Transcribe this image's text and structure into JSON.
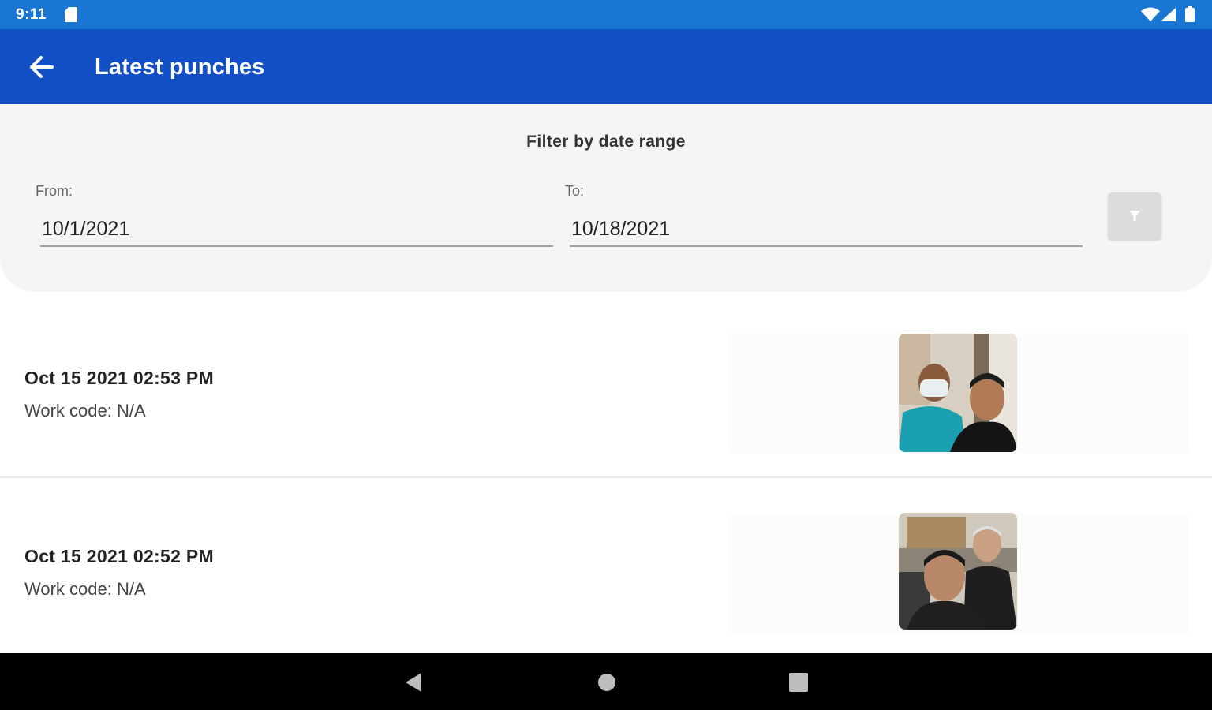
{
  "status_bar": {
    "time": "9:11",
    "icons": [
      "sd-card-icon",
      "wifi-icon",
      "cell-signal-icon",
      "battery-icon"
    ]
  },
  "app_bar": {
    "title": "Latest punches",
    "back_icon": "arrow-back-icon"
  },
  "filter": {
    "heading": "Filter by date range",
    "from_label": "From:",
    "from_value": "10/1/2021",
    "to_label": "To:",
    "to_value": "10/18/2021",
    "apply_icon": "filter-icon"
  },
  "punches": [
    {
      "datetime": "Oct 15 2021 02:53 PM",
      "work_code": "Work code: N/A",
      "photo": "punch-photo"
    },
    {
      "datetime": "Oct 15 2021 02:52 PM",
      "work_code": "Work code: N/A",
      "photo": "punch-photo"
    }
  ],
  "nav_bar": {
    "buttons": [
      "nav-back-icon",
      "nav-home-icon",
      "nav-recents-icon"
    ]
  },
  "colors": {
    "status_bar": "#1976d2",
    "app_bar": "#124ec4",
    "filter_panel": "#f5f5f5"
  }
}
